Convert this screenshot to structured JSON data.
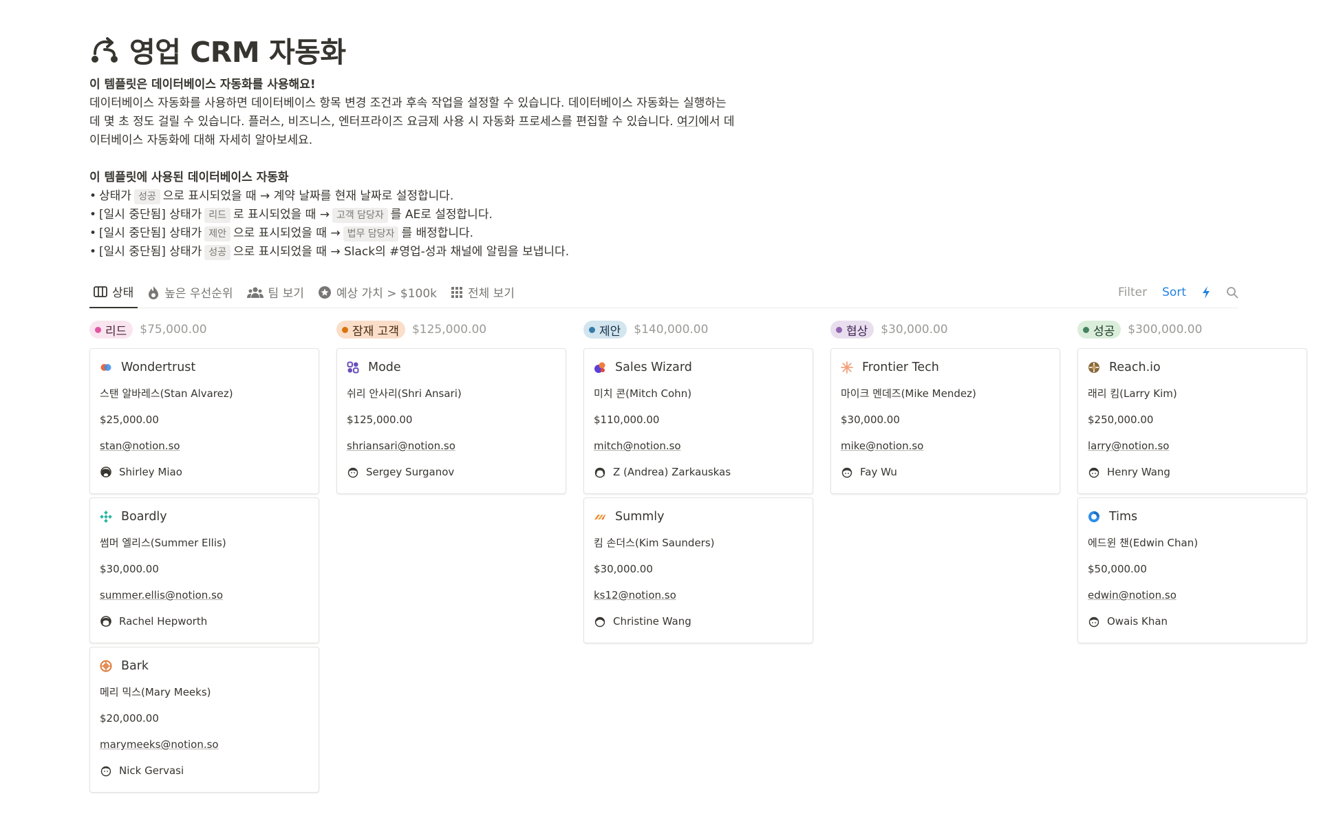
{
  "page": {
    "title": "영업 CRM 자동화",
    "intro_heading": "이 템플릿은 데이터베이스 자동화를 사용해요!",
    "intro_text_1": "데이터베이스 자동화를 사용하면 데이터베이스 항목 변경 조건과 후속 작업을 설정할 수 있습니다. 데이터베이스 자동화는 실행하는",
    "intro_text_2": "데 몇 초 정도 걸릴 수 있습니다. 플러스, 비즈니스, 엔터프라이즈 요금제 사용 시 자동화 프로세스를 편집할 수 있습니다. ",
    "intro_link": "여기",
    "intro_text_3": "에서 데",
    "intro_text_4": "이터베이스 자동화에 대해 자세히 알아보세요.",
    "automations_heading": "이 템플릿에 사용된 데이터베이스 자동화",
    "bullets": [
      {
        "pre": "상태가",
        "tag1": "성공",
        "mid": "으로 표시되었을 때 → 계약 날짜를 현재 날짜로 설정합니다.",
        "tag2": "",
        "post": ""
      },
      {
        "pre": "[일시 중단됨] 상태가",
        "tag1": "리드",
        "mid": "로 표시되었을 때 →",
        "tag2": "고객 담당자",
        "post": "를 AE로 설정합니다."
      },
      {
        "pre": "[일시 중단됨] 상태가",
        "tag1": "제안",
        "mid": "으로 표시되었을 때 →",
        "tag2": "법무 담당자",
        "post": "를 배정합니다."
      },
      {
        "pre": "[일시 중단됨] 상태가",
        "tag1": "성공",
        "mid": "으로 표시되었을 때 → Slack의 #영업-성과 채널에 알림을 보냅니다.",
        "tag2": "",
        "post": ""
      }
    ]
  },
  "views": {
    "tabs": [
      {
        "label": "상태",
        "icon": "board-icon"
      },
      {
        "label": "높은 우선순위",
        "icon": "fire-icon"
      },
      {
        "label": "팀 보기",
        "icon": "people-icon"
      },
      {
        "label": "예상 가치 > $100k",
        "icon": "star-icon"
      },
      {
        "label": "전체 보기",
        "icon": "grid-icon"
      }
    ],
    "filter_label": "Filter",
    "sort_label": "Sort"
  },
  "colors": {
    "lead": "#e255a1",
    "lead_bg": "#f9e5ef",
    "prospect": "#d9730d",
    "prospect_bg": "#fadec9",
    "proposal": "#337ea9",
    "proposal_bg": "#d3e5ef",
    "negotiation": "#9065b0",
    "negotiation_bg": "#e8deee",
    "won": "#448361",
    "won_bg": "#dbeddb",
    "accent": "#2383e2"
  },
  "columns": [
    {
      "label": "리드",
      "sum": "$75,000.00",
      "cards": [
        {
          "company": "Wondertrust",
          "contact": "스탠 알바레스(Stan Alvarez)",
          "value": "$25,000.00",
          "email": "stan@notion.so",
          "owner": "Shirley Miao",
          "logo": "wondertrust-logo"
        },
        {
          "company": "Boardly",
          "contact": "썸머 엘리스(Summer Ellis)",
          "value": "$30,000.00",
          "email": "summer.ellis@notion.so",
          "owner": "Rachel Hepworth",
          "logo": "boardly-logo"
        },
        {
          "company": "Bark",
          "contact": "메리 믹스(Mary Meeks)",
          "value": "$20,000.00",
          "email": "marymeeks@notion.so",
          "owner": "Nick Gervasi",
          "logo": "bark-logo"
        }
      ]
    },
    {
      "label": "잠재 고객",
      "sum": "$125,000.00",
      "cards": [
        {
          "company": "Mode",
          "contact": "쉬리 안사리(Shri Ansari)",
          "value": "$125,000.00",
          "email": "shriansari@notion.so",
          "owner": "Sergey Surganov",
          "logo": "mode-logo"
        }
      ]
    },
    {
      "label": "제안",
      "sum": "$140,000.00",
      "cards": [
        {
          "company": "Sales Wizard",
          "contact": "미치 콘(Mitch Cohn)",
          "value": "$110,000.00",
          "email": "mitch@notion.so",
          "owner": "Z (Andrea) Zarkauskas",
          "logo": "sales-wizard-logo"
        },
        {
          "company": "Summly",
          "contact": "킴 손더스(Kim Saunders)",
          "value": "$30,000.00",
          "email": "ks12@notion.so",
          "owner": "Christine Wang",
          "logo": "summly-logo"
        }
      ]
    },
    {
      "label": "협상",
      "sum": "$30,000.00",
      "cards": [
        {
          "company": "Frontier Tech",
          "contact": "마이크 멘데즈(Mike Mendez)",
          "value": "$30,000.00",
          "email": "mike@notion.so",
          "owner": "Fay Wu",
          "logo": "frontier-tech-logo"
        }
      ]
    },
    {
      "label": "성공",
      "sum": "$300,000.00",
      "cards": [
        {
          "company": "Reach.io",
          "contact": "래리 킴(Larry Kim)",
          "value": "$250,000.00",
          "email": "larry@notion.so",
          "owner": "Henry Wang",
          "logo": "reach-logo"
        },
        {
          "company": "Tims",
          "contact": "에드윈 챈(Edwin Chan)",
          "value": "$50,000.00",
          "email": "edwin@notion.so",
          "owner": "Owais Khan",
          "logo": "tims-logo"
        }
      ]
    }
  ]
}
